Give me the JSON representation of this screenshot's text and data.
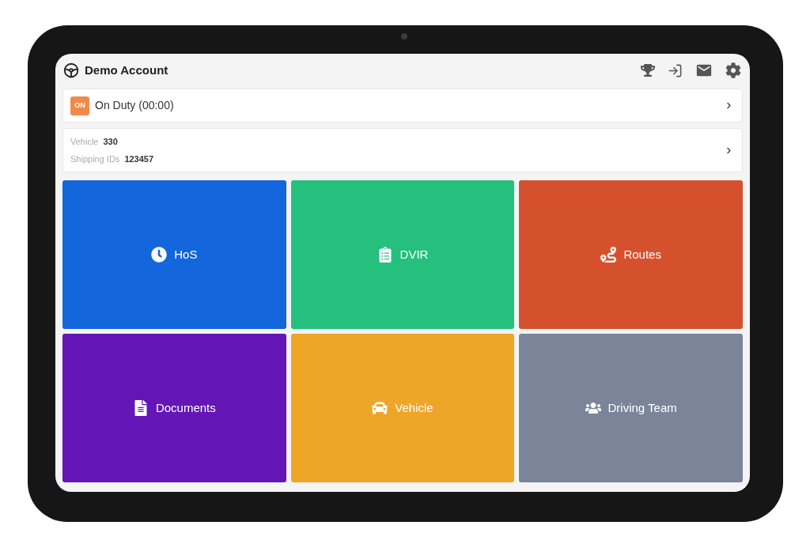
{
  "header": {
    "title": "Demo Account"
  },
  "status": {
    "badge": "ON",
    "label": "On Duty (00:00)"
  },
  "details": [
    {
      "label": "Vehicle",
      "value": "330"
    },
    {
      "label": "Shipping IDs",
      "value": "123457"
    }
  ],
  "tiles": [
    {
      "kind": "clock",
      "label": "HoS",
      "color": "#1366db"
    },
    {
      "kind": "clipboard",
      "label": "DVIR",
      "color": "#25c07e"
    },
    {
      "kind": "route",
      "label": "Routes",
      "color": "#d5512d"
    },
    {
      "kind": "document",
      "label": "Documents",
      "color": "#6315b6"
    },
    {
      "kind": "car",
      "label": "Vehicle",
      "color": "#eea629"
    },
    {
      "kind": "team",
      "label": "Driving Team",
      "color": "#7a8599"
    }
  ]
}
